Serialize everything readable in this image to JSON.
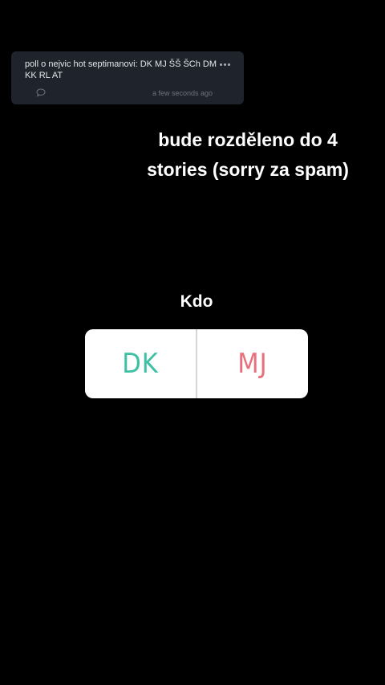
{
  "post": {
    "text": "poll o nejvic hot septimanovi: DK MJ ŠŠ ŠCh DM KK RL AT",
    "timestamp": "a few seconds ago",
    "icons": [
      "more-horizontal-icon",
      "comment-icon"
    ]
  },
  "story": {
    "caption_line1": "bude rozděleno do 4",
    "caption_line2": "stories (sorry za spam)"
  },
  "poll": {
    "question": "Kdo",
    "options": [
      {
        "label": "DK",
        "color": "#3ec0a4"
      },
      {
        "label": "MJ",
        "color": "#e7707c"
      }
    ]
  }
}
